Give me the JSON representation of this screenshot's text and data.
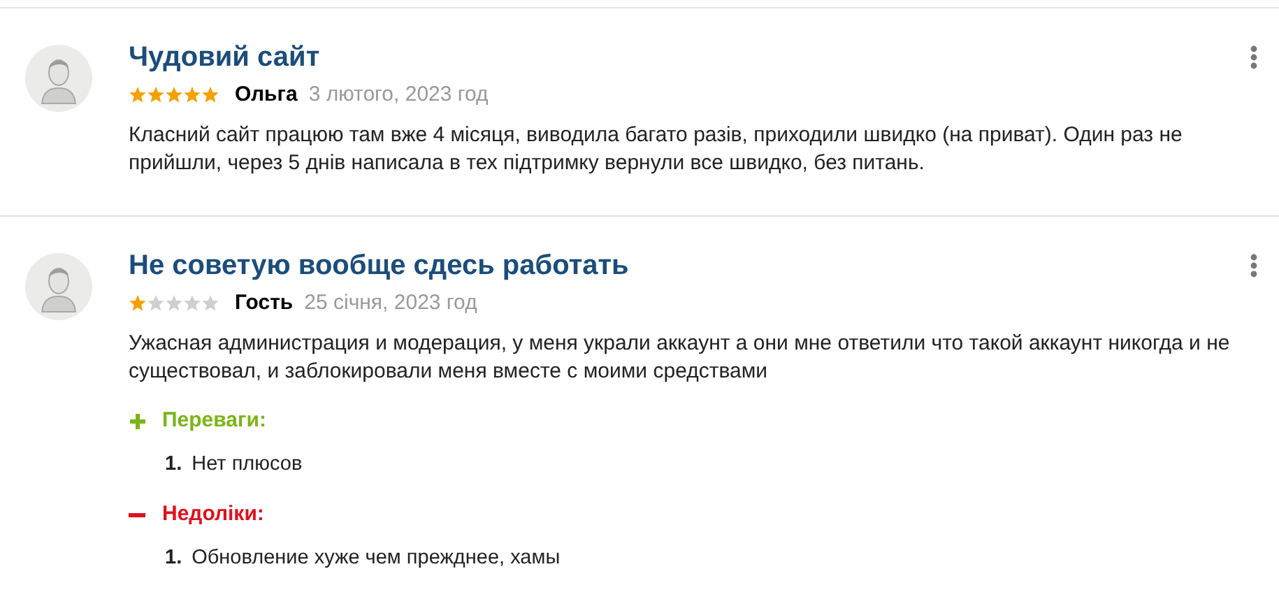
{
  "reviews": [
    {
      "title": "Чудовий сайт",
      "stars": 5,
      "author": "Ольга",
      "date": "3 лютого, 2023 год",
      "text": "Класний сайт працюю там вже 4 місяця, виводила багато разів, приходили швидко (на приват). Один раз не прийшли, через 5 днів написала в тех підтримку вернули все швидко, без питань."
    },
    {
      "title": "Не советую вообще сдесь работать",
      "stars": 1,
      "author": "Гость",
      "date": "25 січня, 2023 год",
      "text": "Ужасная администрация и модерация, у меня украли аккаунт а они мне ответили что такой аккаунт никогда и не существовал, и заблокировали меня вместе с моими средствами",
      "sections": [
        {
          "kind": "pros",
          "heading": "Переваги:",
          "items": [
            {
              "number": "1.",
              "text": "Нет плюсов"
            }
          ]
        },
        {
          "kind": "cons",
          "heading": "Недоліки:",
          "items": [
            {
              "number": "1.",
              "text": "Обновление хуже чем прежднее, хамы"
            }
          ]
        }
      ]
    }
  ]
}
